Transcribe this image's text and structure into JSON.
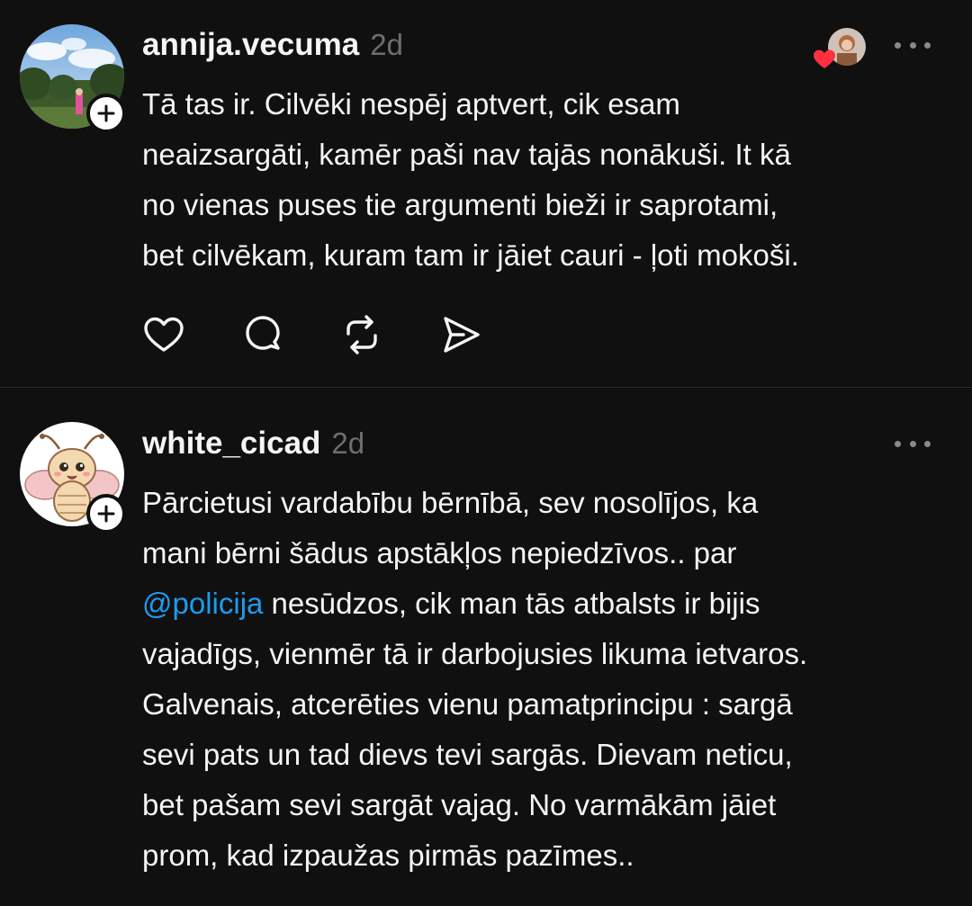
{
  "posts": [
    {
      "username": "annija.vecuma",
      "timestamp": "2d",
      "text": "Tā tas ir. Cilvēki nespēj aptvert, cik esam\nneaizsargāti, kamēr paši nav tajās nonākuši. It kā\nno vienas puses tie argumenti bieži ir saprotami,\nbet cilvēkam, kuram tam ir jāiet cauri - ļoti mokoši."
    },
    {
      "username": "white_cicad",
      "timestamp": "2d",
      "text_before_mention": "Pārcietusi vardabību bērnībā, sev nosolījos, ka\nmani bērni šādus apstākļos nepiedzīvos.. par\n",
      "mention": "@policija",
      "text_after_mention": " nesūdzos, cik man tās atbalsts ir bijis\nvajadīgs, vienmēr tā ir darbojusies likuma ietvaros.\nGalvenais, atcerēties vienu pamatprincipu : sargā\nsevi pats un tad dievs tevi sargās. Dievam neticu,\nbet pašam sevi sargāt vajag. No varmākām jāiet\nprom, kad izpaužas pirmās pazīmes.."
    }
  ],
  "icons": {
    "like": "heart-icon",
    "reply": "comment-icon",
    "repost": "repost-icon",
    "share": "send-icon",
    "more": "more-horizontal-icon",
    "follow": "plus-icon",
    "liked_by": "heart-icon"
  },
  "colors": {
    "background": "#101010",
    "text": "#f3f5f7",
    "muted": "#6e6e6e",
    "mention": "#1d9bf0",
    "heart": "#ff3040",
    "divider": "#2a2a2a"
  }
}
